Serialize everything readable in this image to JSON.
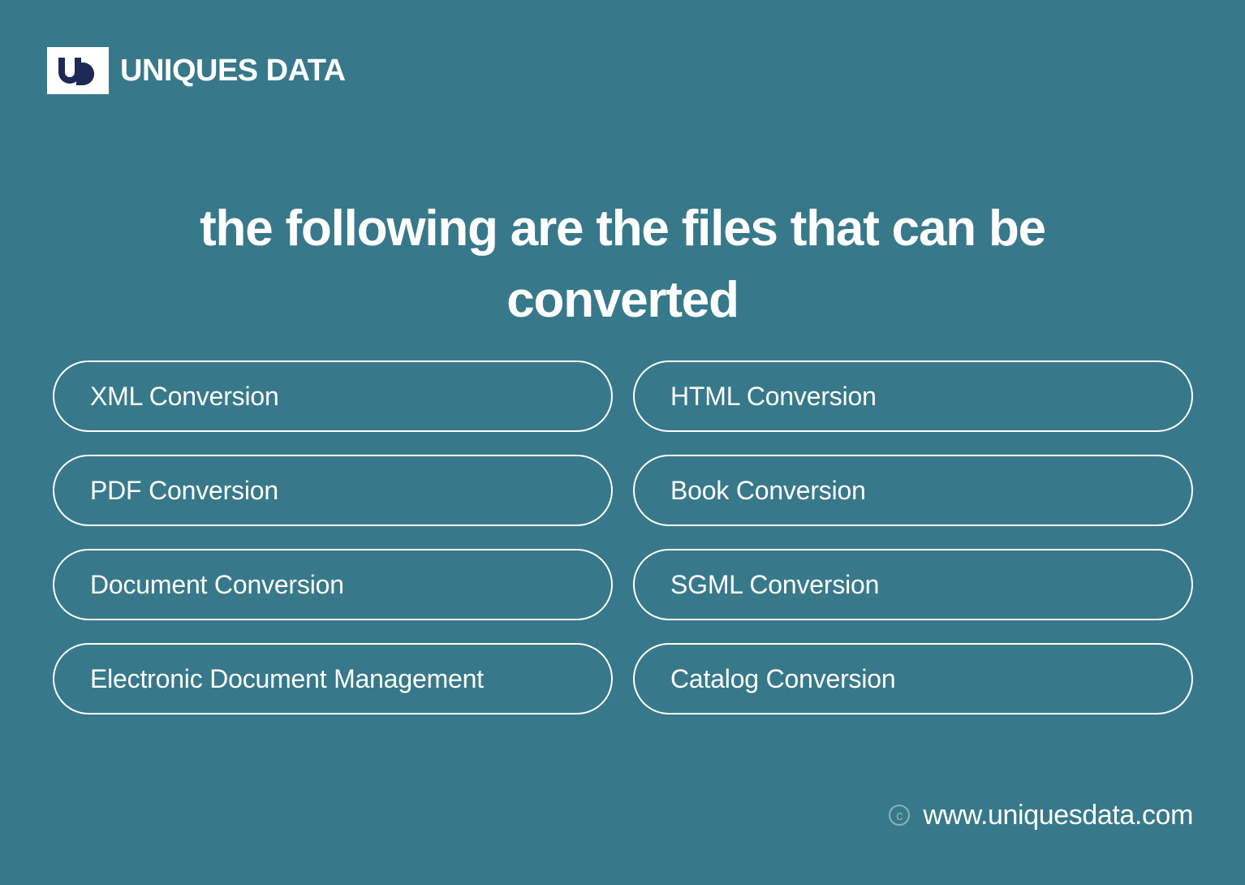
{
  "background_color": "#37798a",
  "brand": {
    "mark_icon": "ud-monogram-icon",
    "mark_color": "#1d2a56",
    "mark_background": "#ffffff",
    "word_primary": "UNIQUES",
    "word_secondary": "DATA"
  },
  "header": {
    "title": "the following are the files that can be converted"
  },
  "conversions": {
    "left_column": [
      {
        "label": "XML Conversion"
      },
      {
        "label": "PDF Conversion"
      },
      {
        "label": "Document Conversion"
      },
      {
        "label": "Electronic Document Management"
      }
    ],
    "right_column": [
      {
        "label": "HTML Conversion"
      },
      {
        "label": "Book Conversion"
      },
      {
        "label": "SGML Conversion"
      },
      {
        "label": "Catalog Conversion"
      }
    ]
  },
  "footer": {
    "copyright_icon": "copyright-icon",
    "copyright_symbol": "c",
    "url": "www.uniquesdata.com"
  }
}
